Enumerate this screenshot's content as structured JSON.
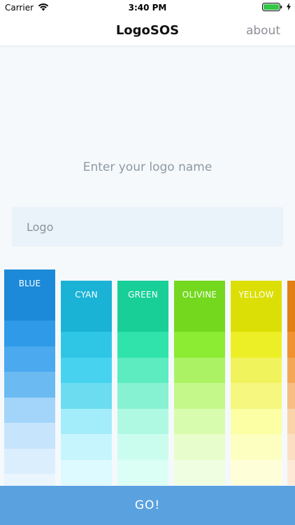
{
  "status_bar": {
    "carrier": "Carrier",
    "time": "3:40 PM",
    "wifi_icon": "wifi-icon",
    "battery_icon": "battery-icon"
  },
  "nav": {
    "title": "LogoSOS",
    "about_label": "about"
  },
  "prompt": "Enter your logo name",
  "input": {
    "placeholder": "Logo",
    "value": ""
  },
  "palettes": [
    {
      "label": "BLUE",
      "selected": true,
      "swatches": [
        "#1c8ad8",
        "#2f9be8",
        "#4aa9ef",
        "#6cbaf2",
        "#a3d4fa",
        "#c6e4fc",
        "#dbeefd",
        "#eaf5fe"
      ]
    },
    {
      "label": "CYAN",
      "selected": false,
      "swatches": [
        "#1ab3d6",
        "#2fc6e6",
        "#47d3ef",
        "#6cdcf0",
        "#a3ecfa",
        "#c7f5fd",
        "#dcfaff"
      ]
    },
    {
      "label": "GREEN",
      "selected": false,
      "swatches": [
        "#18cf98",
        "#2fe3ab",
        "#5cecbf",
        "#87f2d1",
        "#aff9e2",
        "#cafdee",
        "#dcfff5"
      ]
    },
    {
      "label": "OLIVINE",
      "selected": false,
      "swatches": [
        "#73d81e",
        "#8ceb33",
        "#abf364",
        "#c4f88a",
        "#d8fcad",
        "#e7fdcb",
        "#effee0"
      ]
    },
    {
      "label": "YELLOW",
      "selected": false,
      "swatches": [
        "#dcdf05",
        "#ecef25",
        "#f1f35c",
        "#f5f77e",
        "#fcffa3",
        "#fdffc0",
        "#feffd8"
      ]
    },
    {
      "label": "",
      "selected": false,
      "swatches": [
        "#e27f15",
        "#f09232",
        "#f4a857",
        "#f7bd82",
        "#fad3a9",
        "#fcdfc2",
        "#fde9d6"
      ]
    }
  ],
  "go_button": {
    "label": "GO!"
  },
  "colors": {
    "accent": "#5aa1e0",
    "input_background": "#eaf2fa",
    "page_background": "#f5f9fc"
  }
}
